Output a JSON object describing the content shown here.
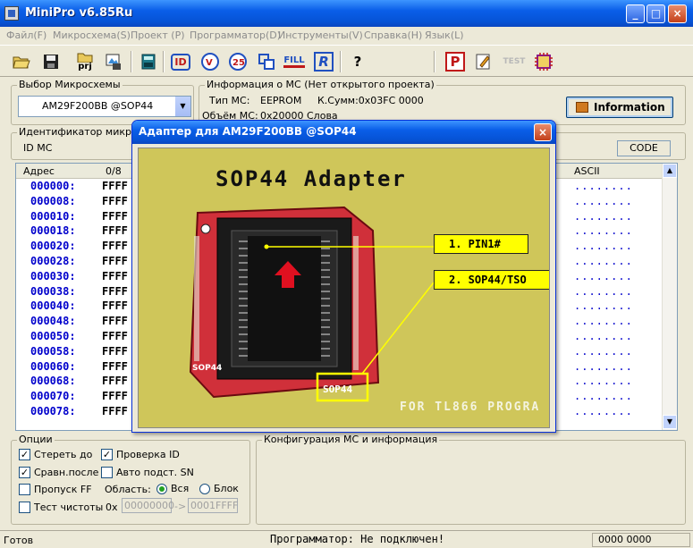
{
  "window": {
    "title": "MiniPro v6.85Ru"
  },
  "menu": [
    "Файл(F)",
    "Микросхема(S)",
    "Проект (P)",
    "Программатор(D)",
    "Инструменты(V)",
    "Справка(H)",
    "Язык(L)"
  ],
  "toolbar": {
    "prj_label": "prj",
    "id_label": "ID",
    "fill_label": "FILL",
    "r_label": "R",
    "help_label": "?",
    "p_label": "P",
    "test_label": "TEST"
  },
  "chip_select": {
    "legend": "Выбор Микросхемы",
    "value": "AM29F200BB  @SOP44"
  },
  "chip_info": {
    "legend": "Информация о МС (Нет открытого проекта)",
    "type_label": "Тип МС:",
    "type_value": "EEPROM",
    "checksum": "К.Сумм:0x03FC 0000",
    "size_label": "Объём МС:",
    "size_value": "0x20000 Слова",
    "info_button": "Information"
  },
  "chip_id": {
    "legend": "Идентификатор микросхемы",
    "label": "ID МС",
    "code": "CODE"
  },
  "hex": {
    "col_addr": "Адрес",
    "col_first": "0/8",
    "col_ascii": "ASCII",
    "rows": [
      {
        "addr": "000000:",
        "data": "FFFF",
        "ascii": "........"
      },
      {
        "addr": "000008:",
        "data": "FFFF",
        "ascii": "........"
      },
      {
        "addr": "000010:",
        "data": "FFFF",
        "ascii": "........"
      },
      {
        "addr": "000018:",
        "data": "FFFF",
        "ascii": "........"
      },
      {
        "addr": "000020:",
        "data": "FFFF",
        "ascii": "........"
      },
      {
        "addr": "000028:",
        "data": "FFFF",
        "ascii": "........"
      },
      {
        "addr": "000030:",
        "data": "FFFF",
        "ascii": "........"
      },
      {
        "addr": "000038:",
        "data": "FFFF",
        "ascii": "........"
      },
      {
        "addr": "000040:",
        "data": "FFFF",
        "ascii": "........"
      },
      {
        "addr": "000048:",
        "data": "FFFF",
        "ascii": "........"
      },
      {
        "addr": "000050:",
        "data": "FFFF",
        "ascii": "........"
      },
      {
        "addr": "000058:",
        "data": "FFFF",
        "ascii": "........"
      },
      {
        "addr": "000060:",
        "data": "FFFF",
        "ascii": "........"
      },
      {
        "addr": "000068:",
        "data": "FFFF",
        "ascii": "........"
      },
      {
        "addr": "000070:",
        "data": "FFFF",
        "ascii": "........"
      },
      {
        "addr": "000078:",
        "data": "FFFF",
        "ascii": "........"
      }
    ]
  },
  "options": {
    "legend": "Опции",
    "erase": "Стереть до",
    "verify_id": "Проверка ID",
    "compare": "Сравн.после",
    "auto_sn": "Авто подст. SN",
    "skip_ff": "Пропуск FF",
    "region_label": "Область:",
    "region_all": "Вся",
    "region_block": "Блок",
    "blank_check": "Тест чистоты",
    "hex_prefix": "0x",
    "addr_from": "00000000",
    "addr_arrow": "->",
    "addr_to": "0001FFFF"
  },
  "config": {
    "legend": "Конфигурация МС и информация"
  },
  "status": {
    "ready": "Готов",
    "programmer": "Программатор: Не подключен!",
    "counter": "0000 0000"
  },
  "dialog": {
    "title": "Адаптер для  AM29F200BB  @SOP44",
    "image_title": "SOP44 Adapter",
    "callout1": "1. PIN1#",
    "callout2": "2. SOP44/TSO",
    "board_label": "SOP44",
    "socket_label": "SOP44",
    "footer": "FOR TL866 PROGRA"
  }
}
